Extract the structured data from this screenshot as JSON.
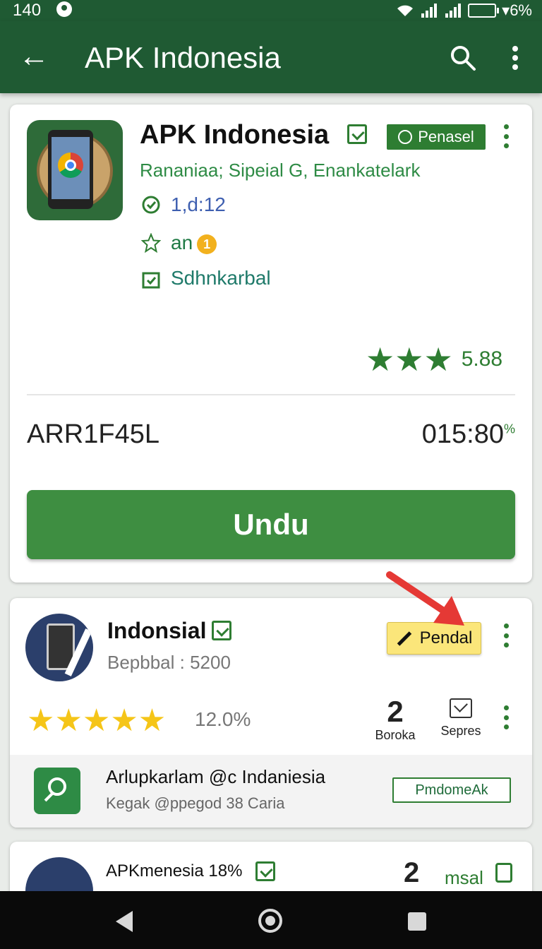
{
  "status_bar": {
    "time": "140",
    "battery": "▾6%"
  },
  "app_bar": {
    "back_icon": "←",
    "title": "APK Indonesia",
    "search_icon": "search-icon",
    "more_icon": "more-vert-icon"
  },
  "featured_app": {
    "title": "APK Indonesia",
    "badge": "Penasel",
    "subtitle": "Rananiaa; Sipeial G, Enankatelark",
    "version": "1,d:12",
    "rating_text": "an",
    "coin": "1",
    "status": "Sdhnkarbal",
    "stars": "★★★",
    "rating_value": "5.88",
    "code_left": "ARR1F45L",
    "code_right": "015:80",
    "code_right_suffix": "%",
    "download_label": "Undu"
  },
  "second_app": {
    "title": "Indonsial",
    "subtitle": "Bepbbal : 5200",
    "action_label": "Pendal",
    "stars": "★★★★★",
    "percent": "12.0%",
    "stat1_value": "2",
    "stat1_label": "Boroka",
    "stat2_label": "Sepres"
  },
  "promo": {
    "title": "Arlupkarlam @c Indaniesia",
    "subtitle": "Kegak @ppegod 38 Caria",
    "button_label": "PmdomeAk"
  },
  "third_app": {
    "title": "APKmenesia 18%",
    "stat_value": "2",
    "label": "msal"
  },
  "colors": {
    "primary": "#1f5a33",
    "accent": "#3e8e41",
    "star": "#f5c518",
    "arrow": "#e53935",
    "action_yellow": "#fbe67a"
  }
}
